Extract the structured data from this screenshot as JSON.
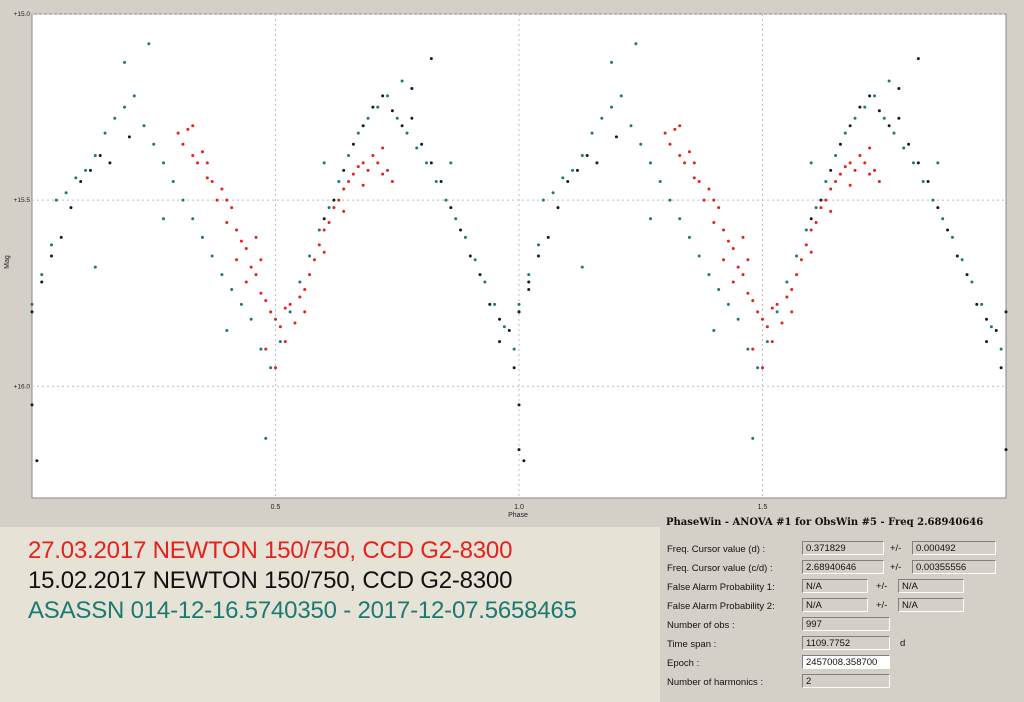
{
  "chart_data": {
    "type": "scatter",
    "xlabel": "Phase",
    "ylabel": "Mag",
    "x_ticks": [
      "0.5",
      "1.0",
      "1.5"
    ],
    "y_ticks": [
      "+15.0",
      "+15.5",
      "+16.0"
    ],
    "xlim": [
      0.0,
      2.0
    ],
    "ylim": [
      15.0,
      16.3
    ],
    "y_inverted": true,
    "grid": true,
    "frequency_c_per_d": 2.68940646,
    "epoch": 2457008.3587,
    "series_colors": {
      "red": "#e8201c",
      "black": "#1a1a1a",
      "teal": "#1a7a73"
    },
    "series": [
      {
        "name": "27.03.2017 NEWTON 150/750, CCD G2-8300",
        "color": "#e8201c",
        "points": [
          [
            0.3,
            15.32
          ],
          [
            0.31,
            15.35
          ],
          [
            0.32,
            15.31
          ],
          [
            0.33,
            15.38
          ],
          [
            0.34,
            15.4
          ],
          [
            0.35,
            15.37
          ],
          [
            0.36,
            15.44
          ],
          [
            0.37,
            15.45
          ],
          [
            0.38,
            15.5
          ],
          [
            0.39,
            15.47
          ],
          [
            0.4,
            15.56
          ],
          [
            0.41,
            15.52
          ],
          [
            0.42,
            15.58
          ],
          [
            0.43,
            15.61
          ],
          [
            0.44,
            15.63
          ],
          [
            0.45,
            15.68
          ],
          [
            0.46,
            15.7
          ],
          [
            0.47,
            15.75
          ],
          [
            0.48,
            15.77
          ],
          [
            0.49,
            15.8
          ],
          [
            0.5,
            15.82
          ],
          [
            0.51,
            15.84
          ],
          [
            0.52,
            15.79
          ],
          [
            0.53,
            15.78
          ],
          [
            0.54,
            15.83
          ],
          [
            0.55,
            15.76
          ],
          [
            0.56,
            15.74
          ],
          [
            0.57,
            15.7
          ],
          [
            0.58,
            15.66
          ],
          [
            0.59,
            15.62
          ],
          [
            0.6,
            15.58
          ],
          [
            0.61,
            15.56
          ],
          [
            0.62,
            15.52
          ],
          [
            0.63,
            15.5
          ],
          [
            0.64,
            15.47
          ],
          [
            0.65,
            15.45
          ],
          [
            0.66,
            15.43
          ],
          [
            0.67,
            15.41
          ],
          [
            0.68,
            15.4
          ],
          [
            0.69,
            15.42
          ],
          [
            0.7,
            15.38
          ],
          [
            0.71,
            15.4
          ],
          [
            0.72,
            15.43
          ],
          [
            0.73,
            15.42
          ],
          [
            0.74,
            15.45
          ],
          [
            0.48,
            15.9
          ],
          [
            0.5,
            15.95
          ],
          [
            0.44,
            15.72
          ],
          [
            0.46,
            15.6
          ],
          [
            0.52,
            15.88
          ],
          [
            0.36,
            15.4
          ],
          [
            0.33,
            15.3
          ],
          [
            0.4,
            15.5
          ],
          [
            0.42,
            15.66
          ],
          [
            0.56,
            15.8
          ],
          [
            0.6,
            15.64
          ],
          [
            0.64,
            15.53
          ],
          [
            0.68,
            15.46
          ],
          [
            0.72,
            15.36
          ],
          [
            0.47,
            15.66
          ]
        ]
      },
      {
        "name": "15.02.2017 NEWTON 150/750, CCD G2-8300",
        "color": "#1a1a1a",
        "points": [
          [
            0.0,
            15.8
          ],
          [
            0.02,
            15.72
          ],
          [
            0.04,
            15.65
          ],
          [
            0.06,
            15.6
          ],
          [
            0.08,
            15.52
          ],
          [
            0.1,
            15.45
          ],
          [
            0.12,
            15.42
          ],
          [
            0.14,
            15.38
          ],
          [
            0.16,
            15.4
          ],
          [
            0.2,
            15.33
          ],
          [
            0.6,
            15.55
          ],
          [
            0.62,
            15.5
          ],
          [
            0.64,
            15.42
          ],
          [
            0.66,
            15.35
          ],
          [
            0.68,
            15.3
          ],
          [
            0.7,
            15.25
          ],
          [
            0.72,
            15.22
          ],
          [
            0.74,
            15.26
          ],
          [
            0.76,
            15.3
          ],
          [
            0.78,
            15.28
          ],
          [
            0.8,
            15.35
          ],
          [
            0.82,
            15.4
          ],
          [
            0.84,
            15.45
          ],
          [
            0.86,
            15.52
          ],
          [
            0.88,
            15.58
          ],
          [
            0.9,
            15.65
          ],
          [
            0.92,
            15.7
          ],
          [
            0.94,
            15.78
          ],
          [
            0.96,
            15.82
          ],
          [
            0.98,
            15.85
          ],
          [
            1.0,
            15.8
          ],
          [
            1.02,
            15.74
          ],
          [
            0.01,
            16.2
          ],
          [
            0.0,
            16.05
          ],
          [
            1.0,
            16.17
          ],
          [
            0.82,
            15.12
          ],
          [
            0.78,
            15.2
          ],
          [
            0.96,
            15.88
          ],
          [
            0.99,
            15.95
          ]
        ]
      },
      {
        "name": "ASASSN 014-12-16.5740350 - 2017-12-07.5658465",
        "color": "#1a7a73",
        "points": [
          [
            0.0,
            15.78
          ],
          [
            0.02,
            15.7
          ],
          [
            0.04,
            15.62
          ],
          [
            0.05,
            15.5
          ],
          [
            0.07,
            15.48
          ],
          [
            0.09,
            15.44
          ],
          [
            0.11,
            15.42
          ],
          [
            0.13,
            15.38
          ],
          [
            0.15,
            15.32
          ],
          [
            0.17,
            15.28
          ],
          [
            0.19,
            15.25
          ],
          [
            0.21,
            15.22
          ],
          [
            0.23,
            15.3
          ],
          [
            0.25,
            15.35
          ],
          [
            0.27,
            15.4
          ],
          [
            0.29,
            15.45
          ],
          [
            0.31,
            15.5
          ],
          [
            0.33,
            15.55
          ],
          [
            0.35,
            15.6
          ],
          [
            0.37,
            15.65
          ],
          [
            0.39,
            15.7
          ],
          [
            0.41,
            15.74
          ],
          [
            0.43,
            15.78
          ],
          [
            0.45,
            15.82
          ],
          [
            0.47,
            15.9
          ],
          [
            0.49,
            15.95
          ],
          [
            0.51,
            15.88
          ],
          [
            0.53,
            15.8
          ],
          [
            0.55,
            15.72
          ],
          [
            0.57,
            15.65
          ],
          [
            0.59,
            15.58
          ],
          [
            0.61,
            15.52
          ],
          [
            0.63,
            15.45
          ],
          [
            0.65,
            15.38
          ],
          [
            0.67,
            15.32
          ],
          [
            0.69,
            15.28
          ],
          [
            0.71,
            15.25
          ],
          [
            0.73,
            15.22
          ],
          [
            0.75,
            15.28
          ],
          [
            0.77,
            15.32
          ],
          [
            0.79,
            15.36
          ],
          [
            0.81,
            15.4
          ],
          [
            0.83,
            15.45
          ],
          [
            0.85,
            15.5
          ],
          [
            0.87,
            15.55
          ],
          [
            0.89,
            15.6
          ],
          [
            0.91,
            15.66
          ],
          [
            0.93,
            15.72
          ],
          [
            0.95,
            15.78
          ],
          [
            0.97,
            15.84
          ],
          [
            0.99,
            15.9
          ],
          [
            0.24,
            15.08
          ],
          [
            0.19,
            15.13
          ],
          [
            0.48,
            16.14
          ],
          [
            0.27,
            15.55
          ],
          [
            0.13,
            15.68
          ],
          [
            0.4,
            15.85
          ],
          [
            0.6,
            15.4
          ],
          [
            0.76,
            15.18
          ],
          [
            0.86,
            15.4
          ]
        ]
      }
    ]
  },
  "legend": {
    "line1": "27.03.2017  NEWTON 150/750, CCD G2-8300",
    "line2": "15.02.2017  NEWTON 150/750, CCD G2-8300",
    "line3": "ASASSN 014-12-16.5740350 - 2017-12-07.5658465"
  },
  "phasewin": {
    "title": "PhaseWin - ANOVA #1 for ObsWin #5 - Freq 2.68940646",
    "rows": [
      {
        "label": "Freq. Cursor value (d) :",
        "value": "0.371829",
        "pm": "+/-",
        "err": "0.000492"
      },
      {
        "label": "Freq. Cursor value (c/d) :",
        "value": "2.68940646",
        "pm": "+/-",
        "err": "0.00355556"
      },
      {
        "label": "False Alarm Probability 1:",
        "value": "N/A",
        "pm": "+/-",
        "err": "N/A"
      },
      {
        "label": "False Alarm Probability 2:",
        "value": "N/A",
        "pm": "+/-",
        "err": "N/A"
      },
      {
        "label": "Number of obs :",
        "value": "997"
      },
      {
        "label": "Time span :",
        "value": "1109.7752",
        "unit": "d"
      },
      {
        "label": "Epoch :",
        "value": "2457008.358700"
      },
      {
        "label": "Number of harmonics :",
        "value": "2"
      }
    ]
  }
}
